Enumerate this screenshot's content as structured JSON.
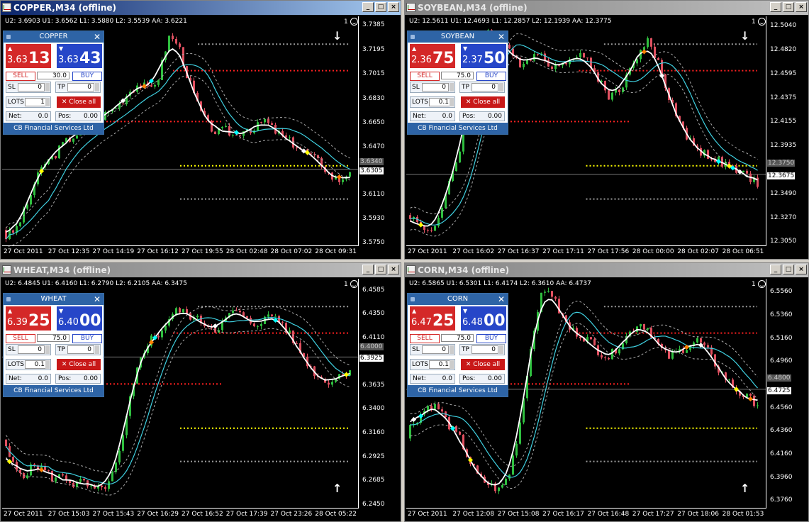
{
  "colors": {
    "bid": "#d42828",
    "ask": "#2646c8",
    "up": "#2fbf3f",
    "down": "#e05060",
    "level_red": "#ff2020",
    "level_yellow": "#ffff00",
    "level_gray": "#9a9a9a",
    "ma": "#3fd0e0",
    "smooth": "#ffffff"
  },
  "windows": [
    {
      "id": "copper",
      "title": "COPPER,M34 (offline)",
      "active": true,
      "info": "U2: 3.6903   U1: 3.6562   L1: 3.5880   L2: 3.5539   AA: 3.6221",
      "badge": "1",
      "arrow": "↓",
      "price_labels": [
        "3.7385",
        "3.7195",
        "3.7015",
        "3.6830",
        "3.6650",
        "3.6470",
        "3.6305",
        "3.6110",
        "3.5930",
        "3.5750"
      ],
      "price_tags": [
        {
          "text": "3.6340",
          "kind": "gray"
        },
        {
          "text": "3.6305",
          "kind": "white"
        }
      ],
      "time_labels": [
        "27 Oct 2011",
        "27 Oct 12:35",
        "27 Oct 14:19",
        "27 Oct 16:12",
        "27 Oct 19:55",
        "28 Oct 02:48",
        "28 Oct 07:02",
        "28 Oct 09:31"
      ],
      "chart_data": {
        "type": "candlestick",
        "start": 3.585,
        "path": [
          3.58,
          3.585,
          3.6,
          3.62,
          3.635,
          3.64,
          3.65,
          3.655,
          3.66,
          3.665,
          3.67,
          3.675,
          3.68,
          3.69,
          3.695,
          3.69,
          3.7,
          3.73,
          3.725,
          3.7,
          3.68,
          3.665,
          3.658,
          3.66,
          3.655,
          3.662,
          3.66,
          3.668,
          3.66,
          3.655,
          3.65,
          3.645,
          3.64,
          3.635,
          3.625,
          3.622,
          3.63
        ],
        "ylim": [
          3.575,
          3.741
        ]
      },
      "panel": {
        "symbol": "COPPER",
        "sell_small": "3.63",
        "sell_big": "13",
        "buy_small": "3.63",
        "buy_big": "43",
        "sell": "SELL",
        "volume": "30.0",
        "buy": "BUY",
        "sl_label": "SL",
        "sl": "0",
        "tp_label": "TP",
        "tp": "0",
        "lots_label": "LOTS",
        "lots": "1",
        "close_all": "Close all",
        "net_label": "Net:",
        "net": "0.0",
        "pos_label": "Pos:",
        "pos": "0.00",
        "footer": "CB Financial Services Ltd"
      }
    },
    {
      "id": "soybean",
      "title": "SOYBEAN,M34 (offline)",
      "active": false,
      "info": "U2: 12.5611   U1: 12.4693   L1: 12.2857   L2: 12.1939   AA: 12.3775",
      "badge": "1",
      "arrow": "↓",
      "price_labels": [
        "12.5040",
        "12.4820",
        "12.4595",
        "12.4375",
        "12.4155",
        "12.3935",
        "12.3750",
        "12.3675",
        "12.3490",
        "12.3270",
        "12.3050"
      ],
      "price_tags": [
        {
          "text": "12.3750",
          "kind": "gray"
        },
        {
          "text": "12.3675",
          "kind": "white"
        }
      ],
      "time_labels": [
        "27 Oct 2011",
        "27 Oct 16:02",
        "27 Oct 16:37",
        "27 Oct 17:11",
        "27 Oct 17:56",
        "28 Oct 00:00",
        "28 Oct 02:07",
        "28 Oct 06:51"
      ],
      "chart_data": {
        "type": "candlestick",
        "start": 12.33,
        "path": [
          12.33,
          12.32,
          12.315,
          12.33,
          12.36,
          12.39,
          12.44,
          12.49,
          12.505,
          12.49,
          12.48,
          12.47,
          12.475,
          12.48,
          12.47,
          12.465,
          12.475,
          12.48,
          12.47,
          12.455,
          12.44,
          12.445,
          12.46,
          12.48,
          12.49,
          12.47,
          12.44,
          12.42,
          12.4,
          12.39,
          12.385,
          12.38,
          12.375,
          12.37,
          12.365,
          12.36
        ],
        "ylim": [
          12.304,
          12.508
        ]
      },
      "panel": {
        "symbol": "SOYBEAN",
        "sell_small": "2.36",
        "sell_big": "75",
        "buy_small": "2.37",
        "buy_big": "50",
        "sell": "SELL",
        "volume": "75.0",
        "buy": "BUY",
        "sl_label": "SL",
        "sl": "0",
        "tp_label": "TP",
        "tp": "0",
        "lots_label": "LOTS",
        "lots": "0.1",
        "close_all": "Close all",
        "net_label": "Net:",
        "net": "0.0",
        "pos_label": "Pos:",
        "pos": "0.00",
        "footer": "CB Financial Services Ltd"
      }
    },
    {
      "id": "wheat",
      "title": "WHEAT,M34 (offline)",
      "active": false,
      "info": "U2: 6.4845   U1: 6.4160   L1: 6.2790   L2: 6.2105   AA: 6.3475",
      "badge": "1",
      "arrow": "↑",
      "price_labels": [
        "6.4585",
        "6.4350",
        "6.4110",
        "6.4000",
        "6.3925",
        "6.3635",
        "6.3400",
        "6.3160",
        "6.2925",
        "6.2685",
        "6.2450"
      ],
      "price_tags": [
        {
          "text": "6.4000",
          "kind": "gray"
        },
        {
          "text": "6.3925",
          "kind": "white"
        }
      ],
      "time_labels": [
        "27 Oct 2011",
        "27 Oct 15:03",
        "27 Oct 15:43",
        "27 Oct 16:29",
        "27 Oct 16:52",
        "27 Oct 17:39",
        "27 Oct 23:26",
        "28 Oct 05:22"
      ],
      "chart_data": {
        "type": "candlestick",
        "start": 6.31,
        "path": [
          6.3,
          6.28,
          6.275,
          6.285,
          6.28,
          6.27,
          6.275,
          6.265,
          6.268,
          6.26,
          6.26,
          6.27,
          6.3,
          6.35,
          6.39,
          6.41,
          6.415,
          6.43,
          6.44,
          6.435,
          6.43,
          6.425,
          6.42,
          6.43,
          6.44,
          6.43,
          6.425,
          6.43,
          6.435,
          6.425,
          6.41,
          6.395,
          6.38,
          6.37,
          6.368,
          6.375,
          6.38
        ],
        "ylim": [
          6.244,
          6.465
        ]
      },
      "panel": {
        "symbol": "WHEAT",
        "sell_small": "6.39",
        "sell_big": "25",
        "buy_small": "6.40",
        "buy_big": "00",
        "sell": "SELL",
        "volume": "75.0",
        "buy": "BUY",
        "sl_label": "SL",
        "sl": "0",
        "tp_label": "TP",
        "tp": "0",
        "lots_label": "LOTS",
        "lots": "0.1",
        "close_all": "Close all",
        "net_label": "Net:",
        "net": "0.0",
        "pos_label": "Pos:",
        "pos": "0.00",
        "footer": "CB Financial Services Ltd"
      }
    },
    {
      "id": "corn",
      "title": "CORN,M34 (offline)",
      "active": false,
      "info": "U2: 6.5865   U1: 6.5301   L1: 6.4174   L2: 6.3610   AA: 6.4737",
      "badge": "1",
      "arrow": "↑",
      "price_labels": [
        "6.5560",
        "6.5360",
        "6.5160",
        "6.4960",
        "6.4800",
        "6.4725",
        "6.4560",
        "6.4360",
        "6.4160",
        "6.3960",
        "6.3760"
      ],
      "price_tags": [
        {
          "text": "6.4800",
          "kind": "gray"
        },
        {
          "text": "6.4725",
          "kind": "white"
        }
      ],
      "time_labels": [
        "27 Oct 2011",
        "27 Oct 12:08",
        "27 Oct 15:08",
        "27 Oct 16:17",
        "27 Oct 16:48",
        "27 Oct 17:27",
        "27 Oct 18:06",
        "28 Oct 01:53"
      ],
      "chart_data": {
        "type": "candlestick",
        "start": 6.43,
        "path": [
          6.44,
          6.45,
          6.46,
          6.455,
          6.44,
          6.43,
          6.41,
          6.395,
          6.39,
          6.385,
          6.4,
          6.44,
          6.5,
          6.55,
          6.56,
          6.54,
          6.525,
          6.52,
          6.515,
          6.505,
          6.5,
          6.51,
          6.52,
          6.53,
          6.525,
          6.51,
          6.5,
          6.505,
          6.51,
          6.515,
          6.505,
          6.49,
          6.48,
          6.47,
          6.465,
          6.46
        ],
        "ylim": [
          6.372,
          6.563
        ]
      },
      "panel": {
        "symbol": "CORN",
        "sell_small": "6.47",
        "sell_big": "25",
        "buy_small": "6.48",
        "buy_big": "00",
        "sell": "SELL",
        "volume": "75.0",
        "buy": "BUY",
        "sl_label": "SL",
        "sl": "0",
        "tp_label": "TP",
        "tp": "0",
        "lots_label": "LOTS",
        "lots": "0.1",
        "close_all": "Close all",
        "net_label": "Net:",
        "net": "0.0",
        "pos_label": "Pos:",
        "pos": "0.00",
        "footer": "CB Financial Services Ltd"
      }
    }
  ]
}
